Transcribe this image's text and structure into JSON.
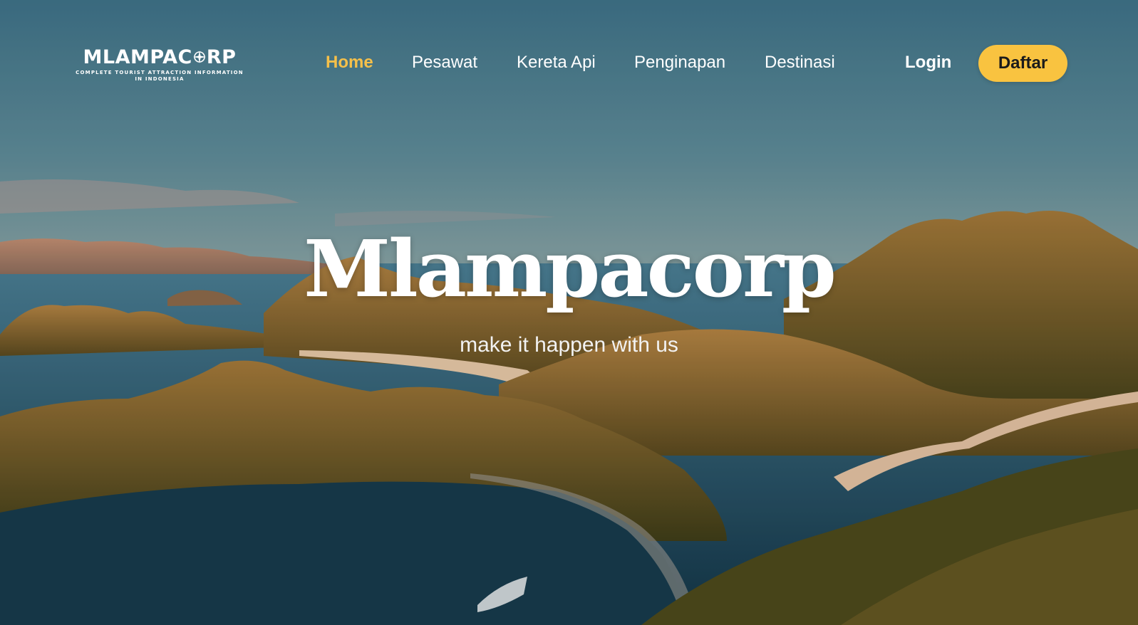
{
  "brand": {
    "name": "MLAMPAC RP",
    "name_left": "MLAMPAC",
    "name_right": "RP",
    "tagline": "COMPLETE TOURIST ATTRACTION INFORMATION IN INDONESIA",
    "icon": "compass-star-icon"
  },
  "nav": {
    "items": [
      {
        "label": "Home",
        "active": true
      },
      {
        "label": "Pesawat",
        "active": false
      },
      {
        "label": "Kereta Api",
        "active": false
      },
      {
        "label": "Penginapan",
        "active": false
      },
      {
        "label": "Destinasi",
        "active": false
      }
    ],
    "active_color": "#f5c04a"
  },
  "auth": {
    "login_label": "Login",
    "register_label": "Daftar",
    "register_color": "#f9c340"
  },
  "hero": {
    "title": "Mlampacorp",
    "subtitle": "make it happen with us",
    "background": "island-landscape-image"
  }
}
